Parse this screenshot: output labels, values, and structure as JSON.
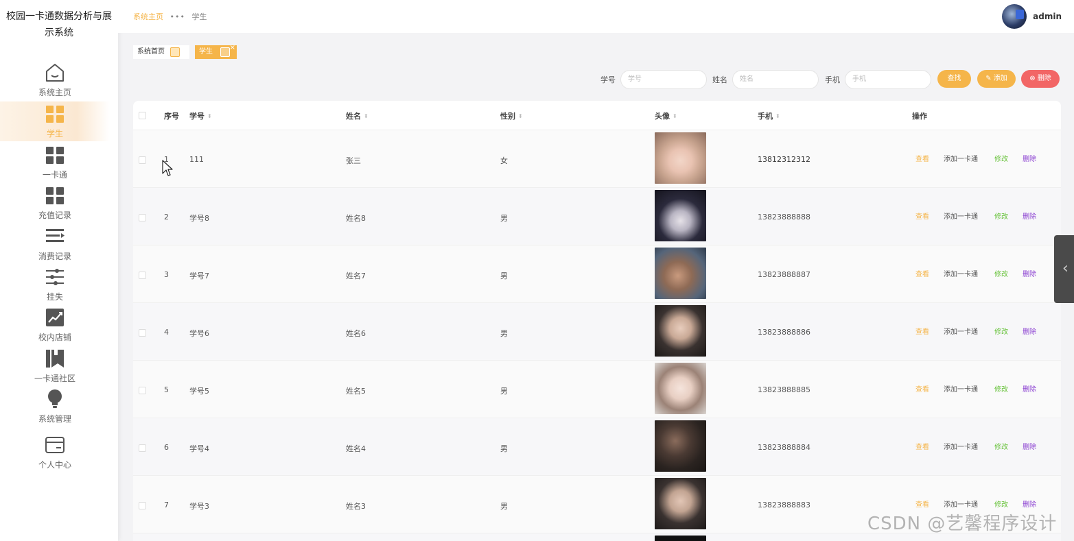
{
  "app": {
    "title": "校园一卡通数据分析与展示系统"
  },
  "sidebar": {
    "items": [
      {
        "label": "系统主页",
        "icon": "home-icon"
      },
      {
        "label": "学生",
        "icon": "grid-icon",
        "active": true
      },
      {
        "label": "一卡通",
        "icon": "grid-icon"
      },
      {
        "label": "充值记录",
        "icon": "grid-icon"
      },
      {
        "label": "消费记录",
        "icon": "list-icon"
      },
      {
        "label": "挂失",
        "icon": "sliders-icon"
      },
      {
        "label": "校内店铺",
        "icon": "trend-chart-icon"
      },
      {
        "label": "一卡通社区",
        "icon": "bookmark-icon"
      },
      {
        "label": "系统管理",
        "icon": "lightbulb-icon"
      },
      {
        "label": "个人中心",
        "icon": "card-icon"
      }
    ]
  },
  "topbar": {
    "breadcrumb": {
      "home": "系统主页",
      "separator": "•••",
      "current": "学生"
    },
    "user": {
      "name": "admin"
    }
  },
  "tabs": [
    {
      "label": "系统首页"
    },
    {
      "label": "学生",
      "close": "×"
    }
  ],
  "search": {
    "fields": [
      {
        "label": "学号",
        "placeholder": "学号"
      },
      {
        "label": "姓名",
        "placeholder": "姓名"
      },
      {
        "label": "手机",
        "placeholder": "手机"
      }
    ],
    "search_label": "查找",
    "add_label": "添加",
    "delete_label": "删除"
  },
  "table": {
    "headers": {
      "index": "序号",
      "student_no": "学号",
      "name": "姓名",
      "gender": "性别",
      "avatar": "头像",
      "phone": "手机",
      "actions": "操作"
    },
    "actions": {
      "view": "查看",
      "add_card": "添加一卡通",
      "edit": "修改",
      "remove": "删除"
    },
    "rows": [
      {
        "index": "1",
        "student_no": "111",
        "name": "张三",
        "gender": "女",
        "phone": "13812312312"
      },
      {
        "index": "2",
        "student_no": "学号8",
        "name": "姓名8",
        "gender": "男",
        "phone": "13823888888"
      },
      {
        "index": "3",
        "student_no": "学号7",
        "name": "姓名7",
        "gender": "男",
        "phone": "13823888887"
      },
      {
        "index": "4",
        "student_no": "学号6",
        "name": "姓名6",
        "gender": "男",
        "phone": "13823888886"
      },
      {
        "index": "5",
        "student_no": "学号5",
        "name": "姓名5",
        "gender": "男",
        "phone": "13823888885"
      },
      {
        "index": "6",
        "student_no": "学号4",
        "name": "姓名4",
        "gender": "男",
        "phone": "13823888884"
      },
      {
        "index": "7",
        "student_no": "学号3",
        "name": "姓名3",
        "gender": "男",
        "phone": "13823888883"
      }
    ]
  },
  "watermark": "CSDN @艺馨程序设计",
  "colors": {
    "accent": "#f5b54a",
    "danger": "#f26666",
    "edit": "#67c23a",
    "remove": "#8a3fd1"
  }
}
